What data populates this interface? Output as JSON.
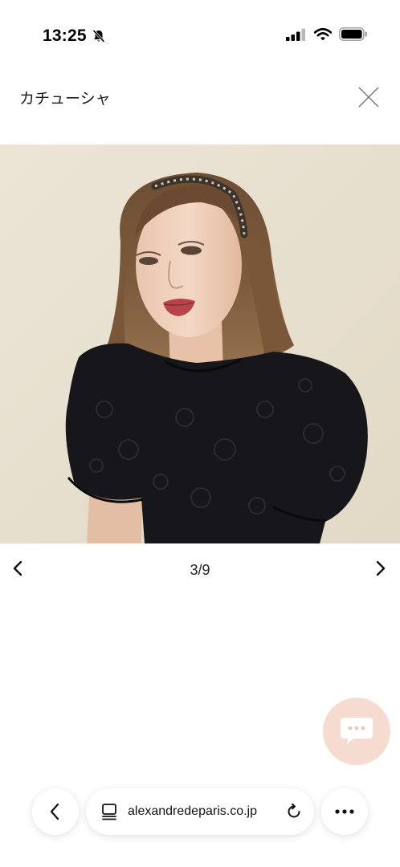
{
  "status_bar": {
    "time": "13:25",
    "icons": [
      "bell-slash-icon",
      "cellular-signal-icon",
      "wifi-icon",
      "battery-icon"
    ]
  },
  "header": {
    "title": "カチューシャ",
    "close_icon": "close-icon"
  },
  "gallery": {
    "current": 3,
    "total": 9,
    "counter_text": "3/9",
    "prev_icon": "chevron-left-icon",
    "next_icon": "chevron-right-icon"
  },
  "chat": {
    "icon": "chat-bubble-icon",
    "color": "#f6dcd0"
  },
  "browser": {
    "url": "alexandredeparis.co.jp",
    "back_icon": "chevron-left-icon",
    "page_icon": "page-settings-icon",
    "reload_icon": "reload-icon",
    "more_icon": "more-icon"
  }
}
